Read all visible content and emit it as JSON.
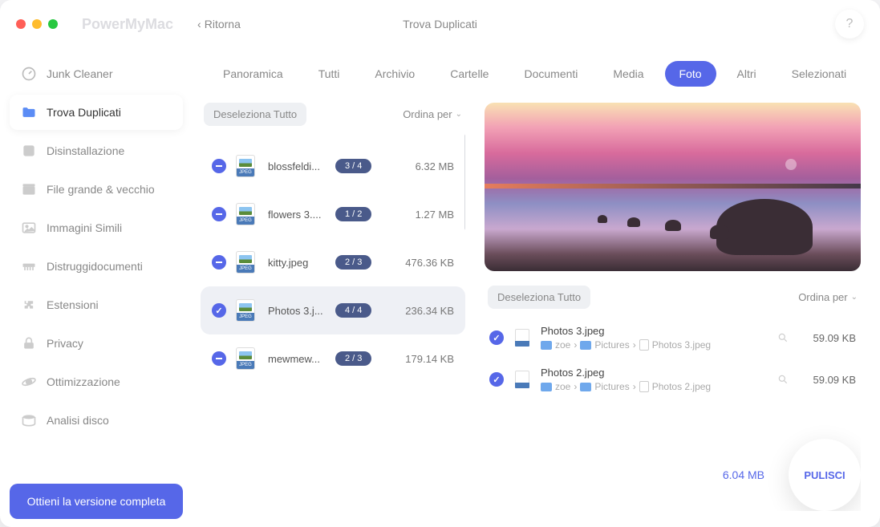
{
  "brand": "PowerMyMac",
  "back_label": "Ritorna",
  "window_title": "Trova Duplicati",
  "help_char": "?",
  "sidebar": {
    "items": [
      {
        "label": "Junk Cleaner",
        "icon": "gauge"
      },
      {
        "label": "Trova Duplicati",
        "icon": "folder",
        "active": true
      },
      {
        "label": "Disinstallazione",
        "icon": "app-grid"
      },
      {
        "label": "File grande & vecchio",
        "icon": "archive"
      },
      {
        "label": "Immagini Simili",
        "icon": "image"
      },
      {
        "label": "Distruggidocumenti",
        "icon": "shredder"
      },
      {
        "label": "Estensioni",
        "icon": "puzzle"
      },
      {
        "label": "Privacy",
        "icon": "lock"
      },
      {
        "label": "Ottimizzazione",
        "icon": "orbit"
      },
      {
        "label": "Analisi disco",
        "icon": "disk"
      }
    ],
    "get_full": "Ottieni la versione completa"
  },
  "tabs": [
    {
      "label": "Panoramica"
    },
    {
      "label": "Tutti"
    },
    {
      "label": "Archivio"
    },
    {
      "label": "Cartelle"
    },
    {
      "label": "Documenti"
    },
    {
      "label": "Media"
    },
    {
      "label": "Foto",
      "active": true
    },
    {
      "label": "Altri"
    },
    {
      "label": "Selezionati"
    }
  ],
  "list": {
    "deselect": "Deseleziona Tutto",
    "sort": "Ordina per",
    "rows": [
      {
        "name": "blossfeldi...",
        "badge": "3 / 4",
        "size": "6.32 MB",
        "check": "minus"
      },
      {
        "name": "flowers 3....",
        "badge": "1 / 2",
        "size": "1.27 MB",
        "check": "minus"
      },
      {
        "name": "kitty.jpeg",
        "badge": "2 / 3",
        "size": "476.36 KB",
        "check": "minus"
      },
      {
        "name": "Photos 3.j...",
        "badge": "4 / 4",
        "size": "236.34 KB",
        "check": "tick",
        "selected": true
      },
      {
        "name": "mewmew...",
        "badge": "2 / 3",
        "size": "179.14 KB",
        "check": "minus"
      }
    ]
  },
  "detail": {
    "deselect": "Deseleziona Tutto",
    "sort": "Ordina per",
    "items": [
      {
        "name": "Photos 3.jpeg",
        "size": "59.09 KB",
        "path": [
          "zoe",
          "Pictures",
          "Photos 3.jpeg"
        ]
      },
      {
        "name": "Photos 2.jpeg",
        "size": "59.09 KB",
        "path": [
          "zoe",
          "Pictures",
          "Photos 2.jpeg"
        ]
      }
    ]
  },
  "footer": {
    "total": "6.04 MB",
    "clean": "PULISCI"
  },
  "icon_label": "JPEG"
}
